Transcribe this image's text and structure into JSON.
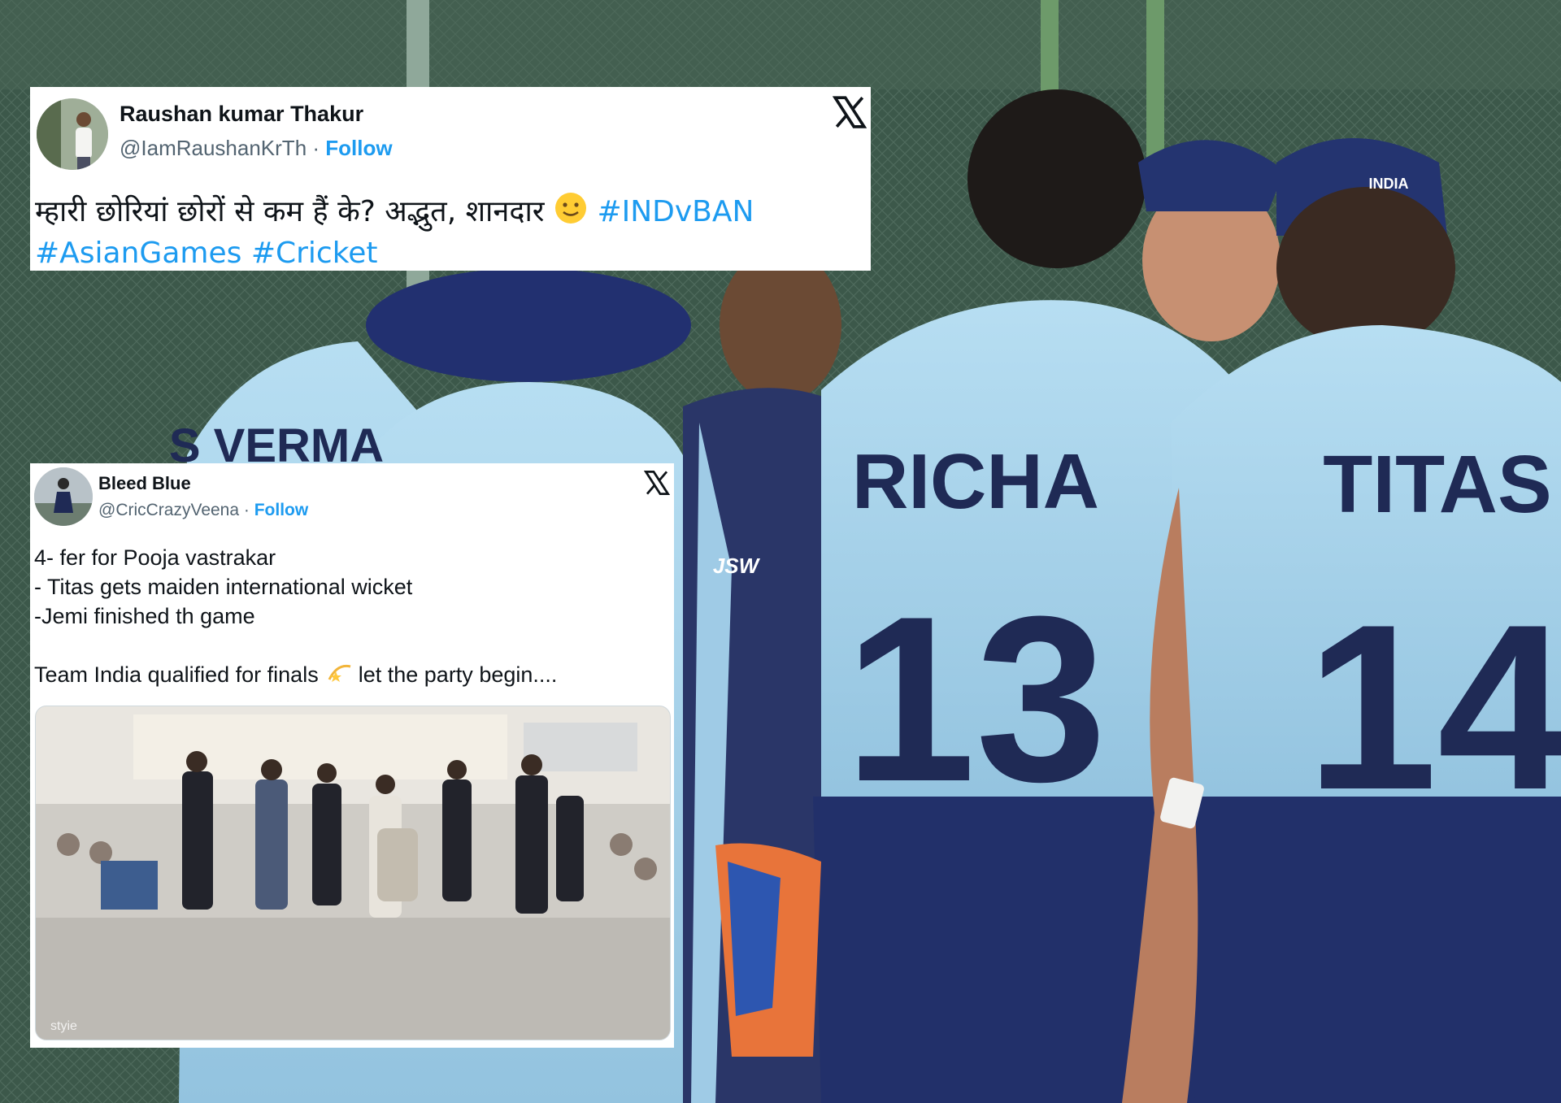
{
  "background": {
    "description_icon": "cricket-team-celebration-photo",
    "jerseys": [
      {
        "name": "RICHA",
        "number": "13"
      },
      {
        "name": "TITAS",
        "number": "14"
      }
    ],
    "cap_text": "INDIA",
    "sponsor_text": "JSW",
    "partial_jersey_name": "S VERMA",
    "colors": {
      "jersey": "#a8d4ec",
      "navy": "#1f2a55",
      "grass": "#3a5a48"
    }
  },
  "tweet1": {
    "display_name": "Raushan kumar Thakur",
    "handle": "@IamRaushanKrTh",
    "separator": " · ",
    "follow_label": "Follow",
    "text_line1": "म्हारी छोरियां छोरों से कम हैं के? अद्भुत, शानदार",
    "emoji_icon": "slightly-smiling-face-icon",
    "hashtag1": "#INDvBAN",
    "hashtag2": "#AsianGames",
    "hashtag3": "#Cricket"
  },
  "tweet2": {
    "display_name": "Bleed Blue",
    "handle": "@CricCrazyVeena",
    "separator": " · ",
    "follow_label": "Follow",
    "lines": [
      "4- fer for Pooja vastrakar",
      "- Titas gets maiden international wicket",
      "-Jemi finished th game"
    ],
    "final_line_a": "Team India qualified for finals",
    "emoji_icon": "dizzy-star-icon",
    "final_line_b": "let the party begin....",
    "media_icon": "wedding-dance-video-thumbnail",
    "media_watermark": "styie"
  },
  "colors": {
    "link": "#1d9bf0",
    "text": "#0f1419",
    "muted": "#536471"
  }
}
